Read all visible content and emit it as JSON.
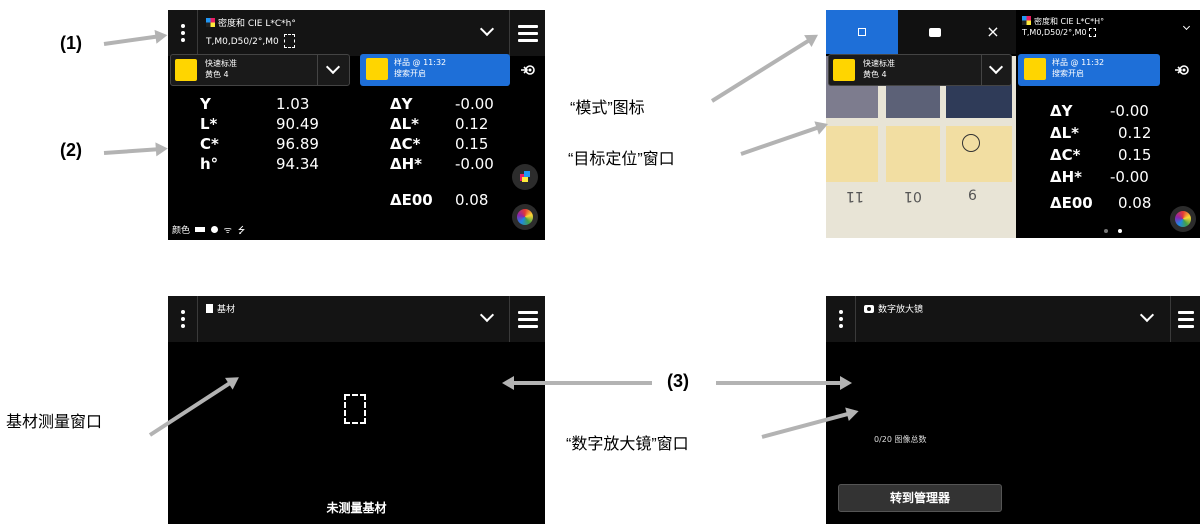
{
  "screen1": {
    "title": "密度和 CIE L*C*h°",
    "subtitle": "T,M0,D50/2°,M0",
    "standard": {
      "line1": "快速标准",
      "line2": "黄色 4"
    },
    "sample": {
      "line1": "样品 @ 11:32",
      "line2": "搜索开启"
    },
    "left_values": [
      {
        "label": "Y",
        "value": "1.03"
      },
      {
        "label": "L*",
        "value": "90.49"
      },
      {
        "label": "C*",
        "value": "96.89"
      },
      {
        "label": "h°",
        "value": "94.34"
      }
    ],
    "delta_values": [
      {
        "label": "ΔY",
        "value": "-0.00"
      },
      {
        "label": "ΔL*",
        "value": "0.12"
      },
      {
        "label": "ΔC*",
        "value": "0.15"
      },
      {
        "label": "ΔH*",
        "value": "-0.00"
      },
      {
        "label": "ΔE00",
        "value": "0.08"
      }
    ],
    "status": "颜色"
  },
  "screen2": {
    "title": "密度和 CIE L*C*H°",
    "subtitle": "T,M0,D50/2°,M0",
    "standard": {
      "line1": "快速标准",
      "line2": "黄色 4"
    },
    "sample": {
      "line1": "样品 @ 11:32",
      "line2": "搜索开启"
    },
    "ruler": [
      "11",
      "01",
      "6"
    ],
    "delta_values": [
      {
        "label": "ΔY",
        "value": "-0.00"
      },
      {
        "label": "ΔL*",
        "value": "0.12"
      },
      {
        "label": "ΔC*",
        "value": "0.15"
      },
      {
        "label": "ΔH*",
        "value": "-0.00"
      },
      {
        "label": "ΔE00",
        "value": "0.08"
      }
    ],
    "close": "×"
  },
  "screen3": {
    "title": "基材",
    "message": "未测量基材"
  },
  "screen4": {
    "title": "数字放大镜",
    "count": "0/20 图像总数",
    "button": "转到管理器"
  },
  "labels": {
    "l1": "(1)",
    "l2": "(2)",
    "l3": "(3)",
    "mode_icon": "“模式”图标",
    "target_window": "“目标定位”窗口",
    "substrate_window": "基材测量窗口",
    "magnifier_window": "“数字放大镜”窗口"
  },
  "colors": {
    "accent_blue": "#1e6fd8",
    "swatch_yellow": "#ffd500",
    "arrow_gray": "#b3b3b3"
  }
}
